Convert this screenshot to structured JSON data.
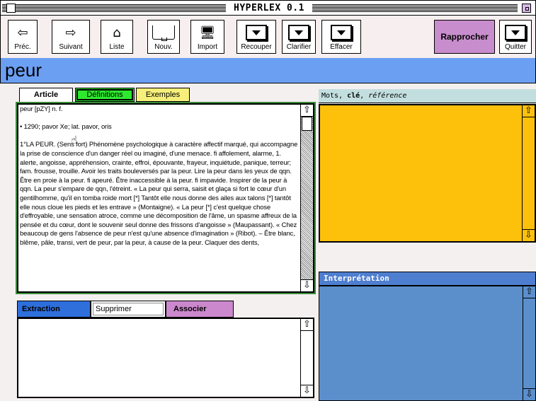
{
  "window": {
    "title": "HYPERLEX 0.1"
  },
  "toolbar": {
    "buttons": [
      {
        "label": "Préc.",
        "icon": "arrow-left-icon"
      },
      {
        "label": "Suivant",
        "icon": "arrow-right-icon"
      },
      {
        "label": "Liste",
        "icon": "home-icon"
      },
      {
        "label": "Nouv.",
        "icon": "tray-icon"
      },
      {
        "label": "Import",
        "icon": "computer-icon"
      },
      {
        "label": "Recouper",
        "icon": "dropdown-icon"
      },
      {
        "label": "Clarifier",
        "icon": "dropdown-icon"
      },
      {
        "label": "Effacer",
        "icon": "dropdown-icon"
      },
      {
        "label": "Rapprocher"
      },
      {
        "label": "Quitter",
        "icon": "dropdown-icon"
      }
    ]
  },
  "entry": {
    "word": "peur"
  },
  "tabs": {
    "article": "Article",
    "definitions": "Définitions",
    "exemples": "Exemples"
  },
  "article": {
    "text": "peur [pZY] n. f.\n\n• 1290; pavor Xe; lat. pavor, oris\n\n1°LA PEUR. (Sens fort) Phénomène psychologique à caractère affectif marqué, qui accompagne la prise de conscience d'un danger réel ou imaginé, d'une menace. fi affolement, alarme, 1. alerte, angoisse, appréhension, crainte, effroi, épouvante, frayeur, inquiétude, panique, terreur; fam. frousse, trouille. Avoir les traits bouleversés par la peur. Lire la peur dans les yeux de qqn. Être en proie à la peur. fi apeuré. Être inaccessible à la peur. fi impavide. Inspirer de la peur à qqn. La peur s'empare de qqn, l'étreint. « La peur qui serra, saisit et glaça si fort le cœur d'un gentilhomme, qu'il en tomba roide mort [*] Tantôt elle nous donne des ailes aux talons [*] tantôt elle nous cloue les pieds et les entrave » (Montaigne). « La peur [*] c'est quelque chose d'effroyable, une sensation atroce, comme une décomposition de l'âme, un spasme affreux de la pensée et du cœur, dont le souvenir seul donne des frissons d'angoisse » (Maupassant). « Chez beaucoup de gens l'absence de peur n'est qu'une absence d'imagination » (Ribot). – Être blanc, blême, pâle, transi, vert de peur, par la peur, à cause de la peur. Claquer des dents,"
  },
  "right": {
    "mots_header": {
      "mots": "Mots",
      "cle": "clé",
      "reference": "référence"
    },
    "interpretation_header": "Interprétation"
  },
  "bottom_tabs": {
    "extraction": "Extraction",
    "supprimer": "Supprimer",
    "associer": "Associer"
  },
  "colors": {
    "wordbar": "#6b9ff2",
    "definitions_tab": "#2ee82e",
    "exemples_tab": "#f6f07a",
    "mots_panel": "#fdc10b",
    "interpretation_panel": "#5b8fcc",
    "rapprocher": "#c88dcc"
  }
}
